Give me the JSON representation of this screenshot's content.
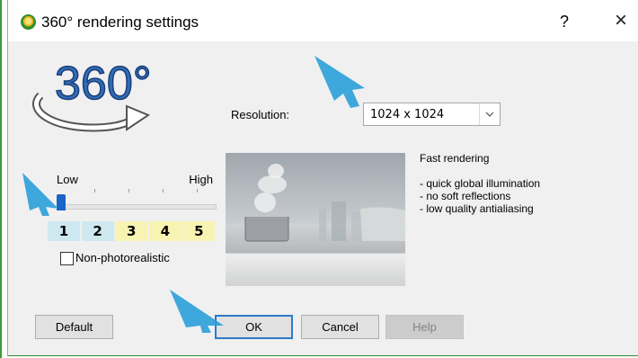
{
  "window": {
    "title": "360° rendering settings",
    "help_glyph": "?",
    "close_glyph": "×"
  },
  "logo": {
    "text": "360°"
  },
  "resolution": {
    "label": "Resolution:",
    "value": "1024 x 1024"
  },
  "quality": {
    "low_label": "Low",
    "high_label": "High",
    "selected_level": 1,
    "levels": [
      "1",
      "2",
      "3",
      "4",
      "5"
    ],
    "level_colors": [
      "#cde9ef",
      "#cde9ef",
      "#f7f3b3",
      "#f7f3b3",
      "#f7f3b3"
    ]
  },
  "non_photorealistic": {
    "label": "Non-photorealistic",
    "checked": false
  },
  "description": {
    "title": "Fast rendering",
    "bullets": [
      "- quick global illumination",
      "- no soft reflections",
      "- low quality antialiasing"
    ]
  },
  "buttons": {
    "default": "Default",
    "ok": "OK",
    "cancel": "Cancel",
    "help": "Help"
  },
  "colors": {
    "accent_blue": "#2a9fd8",
    "titlebar": "#ffffff",
    "dialog_bg": "#f0f0f0"
  }
}
